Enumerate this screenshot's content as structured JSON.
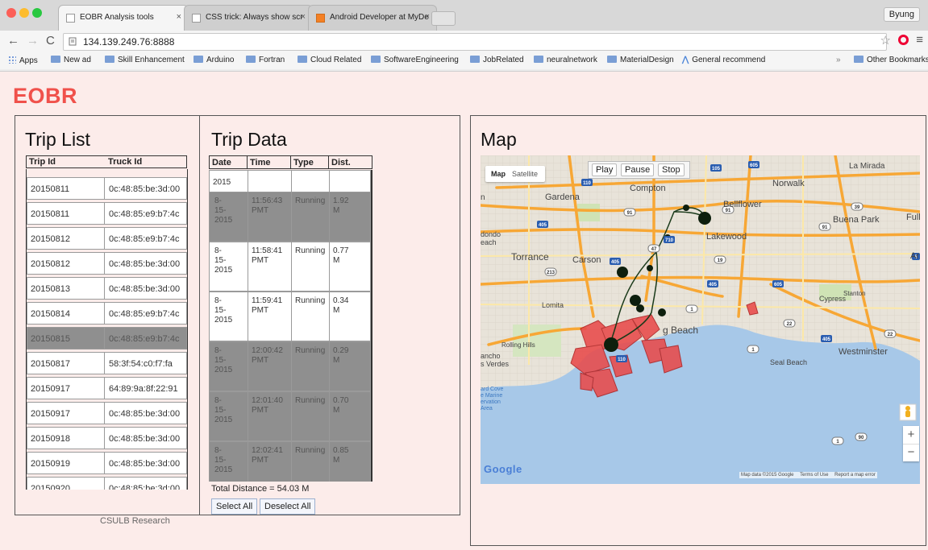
{
  "browser": {
    "tabs": [
      {
        "title": "EOBR Analysis tools",
        "active": true
      },
      {
        "title": "CSS trick: Always show scr",
        "active": false
      },
      {
        "title": "Android Developer at MyDe",
        "active": false
      }
    ],
    "profile": "Byung",
    "url": "134.139.249.76:8888",
    "bookmarks": [
      "Apps",
      "New ad",
      "Skill Enhancement",
      "Arduino",
      "Fortran",
      "Cloud Related",
      "SoftwareEngineering",
      "JobRelated",
      "neuralnetwork",
      "MaterialDesign",
      "General recommend"
    ],
    "bookmarks_more": "»",
    "other_bookmarks": "Other Bookmarks"
  },
  "page": {
    "title": "EOBR",
    "footer": "CSULB Research"
  },
  "trip_list": {
    "title": "Trip List",
    "columns": [
      "Trip Id",
      "Truck Id"
    ],
    "rows": [
      {
        "trip_id": "20150811",
        "truck_id": "0c:48:85:be:3d:00",
        "selected": false
      },
      {
        "trip_id": "20150811",
        "truck_id": "0c:48:85:e9:b7:4c",
        "selected": false
      },
      {
        "trip_id": "20150812",
        "truck_id": "0c:48:85:e9:b7:4c",
        "selected": false
      },
      {
        "trip_id": "20150812",
        "truck_id": "0c:48:85:be:3d:00",
        "selected": false
      },
      {
        "trip_id": "20150813",
        "truck_id": "0c:48:85:be:3d:00",
        "selected": false
      },
      {
        "trip_id": "20150814",
        "truck_id": "0c:48:85:e9:b7:4c",
        "selected": false
      },
      {
        "trip_id": "20150815",
        "truck_id": "0c:48:85:e9:b7:4c",
        "selected": true
      },
      {
        "trip_id": "20150817",
        "truck_id": "58:3f:54:c0:f7:fa",
        "selected": false
      },
      {
        "trip_id": "20150917",
        "truck_id": "64:89:9a:8f:22:91",
        "selected": false
      },
      {
        "trip_id": "20150917",
        "truck_id": "0c:48:85:be:3d:00",
        "selected": false
      },
      {
        "trip_id": "20150918",
        "truck_id": "0c:48:85:be:3d:00",
        "selected": false
      },
      {
        "trip_id": "20150919",
        "truck_id": "0c:48:85:be:3d:00",
        "selected": false
      },
      {
        "trip_id": "20150920",
        "truck_id": "0c:48:85:be:3d:00",
        "selected": false
      }
    ]
  },
  "trip_data": {
    "title": "Trip Data",
    "columns": [
      "Date",
      "Time",
      "Type",
      "Dist."
    ],
    "partial_first_date": "2015",
    "rows": [
      {
        "date": [
          "8-",
          "15-",
          "2015"
        ],
        "time": [
          "11:56:43",
          "PMT"
        ],
        "type": "Running",
        "dist": [
          "1.92",
          "M"
        ],
        "selected": true
      },
      {
        "date": [
          "8-",
          "15-",
          "2015"
        ],
        "time": [
          "11:58:41",
          "PMT"
        ],
        "type": "Running",
        "dist": [
          "0.77",
          "M"
        ],
        "selected": false
      },
      {
        "date": [
          "8-",
          "15-",
          "2015"
        ],
        "time": [
          "11:59:41",
          "PMT"
        ],
        "type": "Running",
        "dist": [
          "0.34",
          "M"
        ],
        "selected": false
      },
      {
        "date": [
          "8-",
          "15-",
          "2015"
        ],
        "time": [
          "12:00:42",
          "PMT"
        ],
        "type": "Running",
        "dist": [
          "0.29",
          "M"
        ],
        "selected": true
      },
      {
        "date": [
          "8-",
          "15-",
          "2015"
        ],
        "time": [
          "12:01:40",
          "PMT"
        ],
        "type": "Running",
        "dist": [
          "0.70",
          "M"
        ],
        "selected": true
      },
      {
        "date": [
          "8-",
          "15-",
          "2015"
        ],
        "time": [
          "12:02:41",
          "PMT"
        ],
        "type": "Running",
        "dist": [
          "0.85",
          "M"
        ],
        "selected": true
      }
    ],
    "total": "Total Distance = 54.03 M",
    "select_all": "Select All",
    "deselect_all": "Deselect All"
  },
  "map": {
    "title": "Map",
    "type_map": "Map",
    "type_satellite": "Satellite",
    "play": "Play",
    "pause": "Pause",
    "stop": "Stop",
    "zoom_in": "+",
    "zoom_out": "−",
    "logo": "Google",
    "attribution": "Map data ©2015 Google",
    "terms": "Terms of Use",
    "report": "Report a map error",
    "places": {
      "la_mirada": "La Mirada",
      "norwalk": "Norwalk",
      "compton": "Compton",
      "gardena": "Gardena",
      "bellflower": "Bellflower",
      "buena_park": "Buena Park",
      "fullerton": "Full",
      "lakewood": "Lakewood",
      "torrance": "Torrance",
      "carson": "Carson",
      "cypress": "Cypress",
      "stanton": "Stanton",
      "lomita": "Lomita",
      "long_beach": "g Beach",
      "rolling_hills": "Rolling Hills",
      "ancho": "ancho",
      "verdes": "s Verdes",
      "westminster": "Westminster",
      "seal_beach": "Seal Beach",
      "dondo": "dondo",
      "each": "each",
      "ar": "Ar",
      "n": "n",
      "cove": "ard Cove",
      "marine": "e Marine",
      "reservation": "ervation",
      "area": "Area"
    },
    "highways": [
      "105",
      "605",
      "110",
      "91",
      "91",
      "405",
      "91",
      "405",
      "605",
      "710",
      "213",
      "19",
      "405",
      "22",
      "22",
      "1",
      "1",
      "110",
      "405",
      "39",
      "5",
      "47",
      "90",
      "1"
    ]
  },
  "colors": {
    "title_red": "#f0514b",
    "page_bg": "#fcecea",
    "selected_row": "#8f8f8f",
    "water": "#a7c8e8",
    "freeway": "#f7a735",
    "route": "#1a3a1a",
    "zone": "#e84a4a"
  }
}
